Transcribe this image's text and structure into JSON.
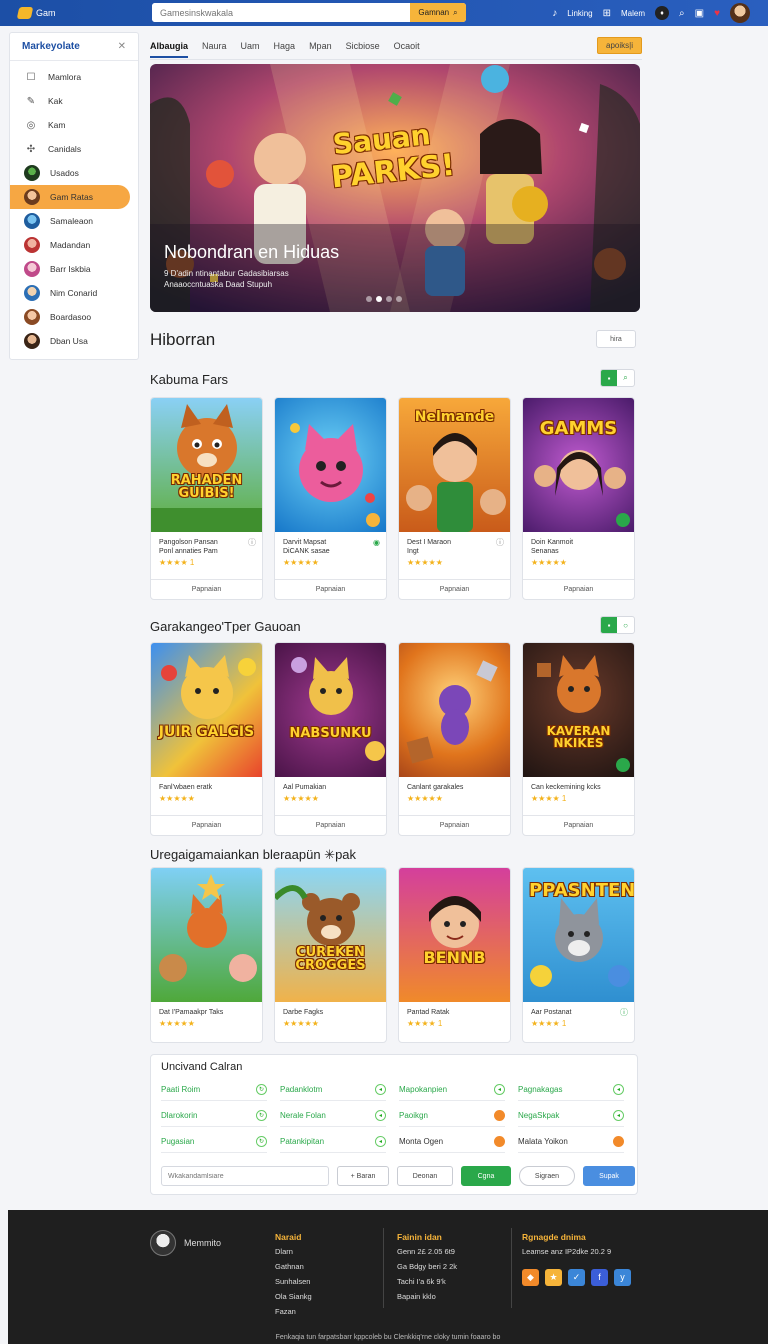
{
  "app": {
    "logo": "Gam"
  },
  "search": {
    "placeholder": "Gamesinskwakala",
    "button": "Gamnan"
  },
  "topnav": {
    "item1": "Linking",
    "item2": "Malem"
  },
  "sidebar": {
    "title": "Markeyolate",
    "items": [
      {
        "label": "Mamlora",
        "icon": "square-icon"
      },
      {
        "label": "Kak",
        "icon": "edit-icon"
      },
      {
        "label": "Kam",
        "icon": "camera-icon"
      },
      {
        "label": "Canidals",
        "icon": "puzzle-icon"
      },
      {
        "label": "Usados",
        "icon": "avatar"
      },
      {
        "label": "Gam Ratas",
        "icon": "avatar",
        "active": true
      },
      {
        "label": "Samaleaon",
        "icon": "avatar"
      },
      {
        "label": "Madandan",
        "icon": "avatar"
      },
      {
        "label": "Barr Iskbia",
        "icon": "avatar"
      },
      {
        "label": "Nim Conarid",
        "icon": "avatar"
      },
      {
        "label": "Boardasoo",
        "icon": "avatar"
      },
      {
        "label": "Dban Usa",
        "icon": "avatar"
      }
    ]
  },
  "tabs": [
    "Albaugia",
    "Naura",
    "Uam",
    "Haga",
    "Mpan",
    "Sicbiose",
    "Ocaoit"
  ],
  "tab_action": "apoiks|i",
  "hero": {
    "badge_line1": "Sauan",
    "badge_line2": "PARKS!",
    "title": "Nobondran en Hiduas",
    "subtitle": "9 D'adin ntinantabur Gadasibiarsas Anaaoccntuaska Daad Stupuh"
  },
  "page_heading": "Hiborran",
  "page_heading_btn": "hira",
  "sections": [
    {
      "title": "Kabuma Fars",
      "cards": [
        {
          "art": "RAHADEN GUIBIS!",
          "line1": "Pangolson Pansan",
          "line2": "Ponl annaties Pam",
          "rating": "★★★★ 1",
          "button": "Papnaian"
        },
        {
          "art": "",
          "line1": "Darvit Mapsat",
          "line2": "DiCANK sasae",
          "rating": "★★★★★",
          "button": "Papnaian"
        },
        {
          "art": "Nelmande",
          "line1": "Dest I Maraon",
          "line2": "Ingt",
          "rating": "★★★★★",
          "button": "Papnaian"
        },
        {
          "art": "GAMMS",
          "line1": "Doin Kanmoit",
          "line2": "Senanas",
          "rating": "★★★★★",
          "button": "Papnaian"
        }
      ]
    },
    {
      "title": "Garakangeo'Tper Gauoan",
      "cards": [
        {
          "art": "JUIR GALGIS",
          "line1": "Fanl'wbaen eratk",
          "rating": "★★★★★",
          "button": "Papnaian"
        },
        {
          "art": "NABSUNKU",
          "line1": "Aal Pumakian",
          "rating": "★★★★★",
          "button": "Papnaian"
        },
        {
          "art": "",
          "line1": "Canlant garakales",
          "rating": "★★★★★",
          "button": "Papnaian"
        },
        {
          "art": "KAVERAN NKIKES",
          "line1": "Can keckemining kcks",
          "rating": "★★★★ 1",
          "button": "Papnaian"
        }
      ]
    },
    {
      "title": "Uregaigamaiankan bleraapün ✳pak",
      "cards": [
        {
          "art": "",
          "line1": "Dat I'Pamaakpr Taks",
          "rating": "★★★★★"
        },
        {
          "art": "CUREKEN CROGGES",
          "line1": "Darbe Fagks",
          "rating": "★★★★★"
        },
        {
          "art": "BENNB",
          "line1": "Pantad Ratak",
          "rating": "★★★★ 1"
        },
        {
          "art": "PPASNTEN",
          "line1": "Aar Postanat",
          "rating": "★★★★ 1"
        }
      ]
    }
  ],
  "panel": {
    "title": "Uncivand Calran",
    "rows": [
      [
        "Paati Roim",
        "Padanklotm",
        "Mapokanpien",
        "Pagnakagas"
      ],
      [
        "Dlarokorin",
        "Nerale Folan",
        "Paoikgn",
        "NegaSkpak"
      ],
      [
        "Pugasian",
        "Patankipitan",
        "Monta Ogen",
        "Malata Yoikon"
      ]
    ],
    "input_placeholder": "Wkakandamlsiare",
    "btn1": "+ Baran",
    "btn2": "Deonan",
    "btn3": "Cgna",
    "btn4": "Sigraen",
    "btn5": "Supak"
  },
  "footer": {
    "brand": "Memmito",
    "col1": {
      "title": "Naraid",
      "items": [
        "Dlarn",
        "Gathnan",
        "Sunhalsen",
        "Ola Siankg",
        "Fazan"
      ]
    },
    "col2": {
      "title": "Fainin idan",
      "items": [
        "Genn 2£ 2.05 6t9",
        "Ga Bdgy beri 2 2k",
        "Tachi I'a 6k 9'k",
        "Bapain kklo"
      ]
    },
    "col3": {
      "title": "Rgnagde dnima",
      "items": [
        "Leamse anz IP2dke 20.2 9"
      ]
    },
    "copyright": "Fenkaqia tun farpatsbarr kppcoleb bu Clenkkiq'rne cloky tumin foaaro bo"
  },
  "colors": {
    "brand": "#1d4fa3",
    "accent": "#f6b43a",
    "success": "#2aa84a"
  }
}
